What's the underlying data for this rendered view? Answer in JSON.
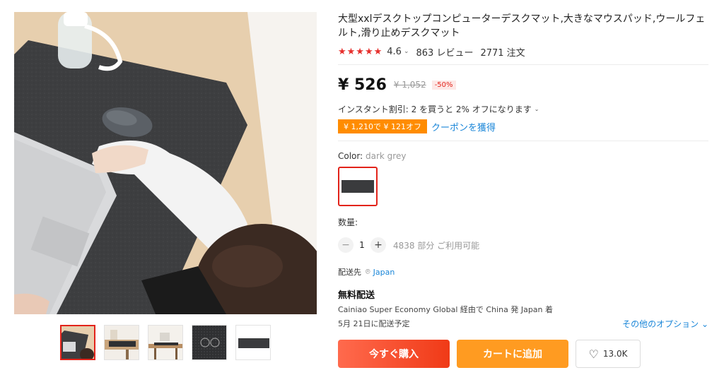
{
  "product": {
    "title": "大型xxlデスクトップコンピューターデスクマット,大きなマウスパッド,ウールフェルト,滑り止めデスクマット",
    "rating": {
      "stars": "★★★★★",
      "score": "4.6",
      "reviews": "863 レビュー",
      "orders": "2771 注文"
    },
    "price": {
      "current": "¥ 526",
      "original": "¥ 1,052",
      "discount": "-50%"
    },
    "instant_discount": "インスタント割引: 2 を買うと 2% オフになります",
    "coupon": {
      "badge": "¥ 1,210で ¥ 121オフ",
      "link": "クーポンを獲得"
    },
    "color": {
      "label": "Color:",
      "value": "dark grey",
      "swatch_color": "#3a3b3d"
    },
    "quantity": {
      "label": "数量:",
      "minus": "−",
      "value": "1",
      "plus": "+",
      "available": "4838 部分 ご利用可能"
    },
    "shipping": {
      "to_label": "配送先",
      "country": "Japan",
      "free_label": "無料配送",
      "detail": "Cainiao Super Economy Global 経由で China 発 Japan 着",
      "date": "5月 21日に配送予定",
      "other_options": "その他のオプション"
    },
    "buttons": {
      "buy_now": "今すぐ購入",
      "add_to_cart": "カートに追加",
      "wishlist_count": "13.0K"
    }
  },
  "gallery": {
    "thumbnails": 5,
    "active_index": 0
  },
  "colors": {
    "accent_red": "#e2231a",
    "star_red": "#e62e2b",
    "coupon_orange": "#ff8c00",
    "link_blue": "#1a86d8",
    "buy_start": "#ff6a4d",
    "buy_end": "#f03a17",
    "cart_orange": "#ff9b21"
  }
}
